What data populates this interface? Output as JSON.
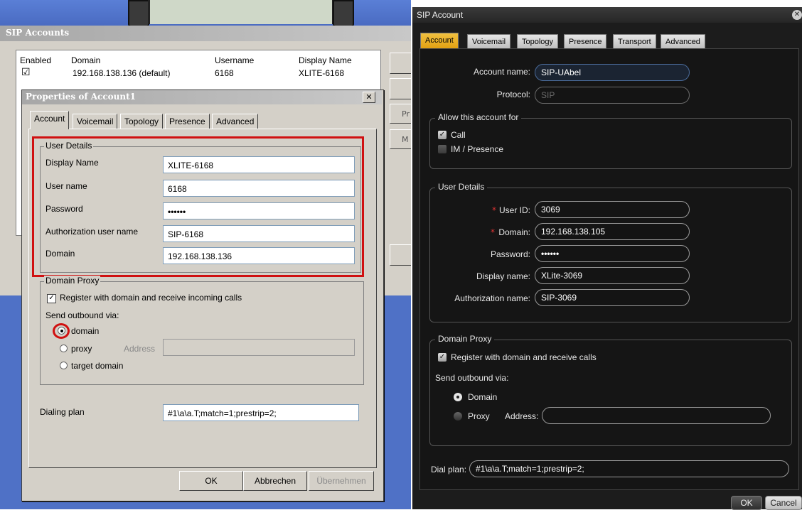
{
  "classic": {
    "sip_accounts_title": "SIP Accounts",
    "columns": [
      "Enabled",
      "Domain",
      "Username",
      "Display Name"
    ],
    "row": {
      "enabled_mark": "☑",
      "domain": "192.168.138.136 (default)",
      "username": "6168",
      "display_name": "XLITE-6168"
    },
    "side_buttons": [
      "Pr",
      "M"
    ],
    "properties_title": "Properties of Account1",
    "close_glyph": "✕",
    "tabs": [
      "Account",
      "Voicemail",
      "Topology",
      "Presence",
      "Advanced"
    ],
    "user_details": {
      "legend": "User Details",
      "fields": [
        {
          "label": "Display Name",
          "value": "XLITE-6168"
        },
        {
          "label": "User name",
          "value": "6168"
        },
        {
          "label": "Password",
          "value": "••••••"
        },
        {
          "label": "Authorization user name",
          "value": "SIP-6168"
        },
        {
          "label": "Domain",
          "value": "192.168.138.136"
        }
      ]
    },
    "domain_proxy": {
      "legend": "Domain Proxy",
      "register_label": "Register with domain and receive incoming calls",
      "register_checked": true,
      "send_via_label": "Send outbound via:",
      "options": [
        "domain",
        "proxy",
        "target domain"
      ],
      "selected": "domain",
      "address_label": "Address",
      "address_value": ""
    },
    "dialing_plan": {
      "label": "Dialing plan",
      "value": "#1\\a\\a.T;match=1;prestrip=2;"
    },
    "buttons": {
      "ok": "OK",
      "cancel": "Abbrechen",
      "apply": "Übernehmen"
    }
  },
  "modern": {
    "title": "SIP Account",
    "close_glyph": "✕",
    "tabs": [
      "Account",
      "Voicemail",
      "Topology",
      "Presence",
      "Transport",
      "Advanced"
    ],
    "account_name": {
      "label": "Account name:",
      "value": "SIP-UAbel"
    },
    "protocol": {
      "label": "Protocol:",
      "value": "SIP"
    },
    "allow": {
      "legend": "Allow this account for",
      "call": {
        "label": "Call",
        "checked": true
      },
      "im": {
        "label": "IM / Presence",
        "checked": false
      }
    },
    "user_details": {
      "legend": "User Details",
      "required_mark": "*",
      "fields": [
        {
          "label": "User ID:",
          "value": "3069",
          "required": true
        },
        {
          "label": "Domain:",
          "value": "192.168.138.105",
          "required": true
        },
        {
          "label": "Password:",
          "value": "••••••",
          "required": false
        },
        {
          "label": "Display name:",
          "value": "XLite-3069",
          "required": false
        },
        {
          "label": "Authorization name:",
          "value": "SIP-3069",
          "required": false
        }
      ]
    },
    "domain_proxy": {
      "legend": "Domain Proxy",
      "register_label": "Register with domain and receive calls",
      "register_checked": true,
      "send_via_label": "Send outbound via:",
      "domain_label": "Domain",
      "proxy_label": "Proxy",
      "address_label": "Address:",
      "address_value": "",
      "selected": "Domain"
    },
    "dial_plan": {
      "label": "Dial plan:",
      "value": "#1\\a\\a.T;match=1;prestrip=2;"
    },
    "buttons": {
      "ok": "OK",
      "cancel": "Cancel"
    }
  }
}
